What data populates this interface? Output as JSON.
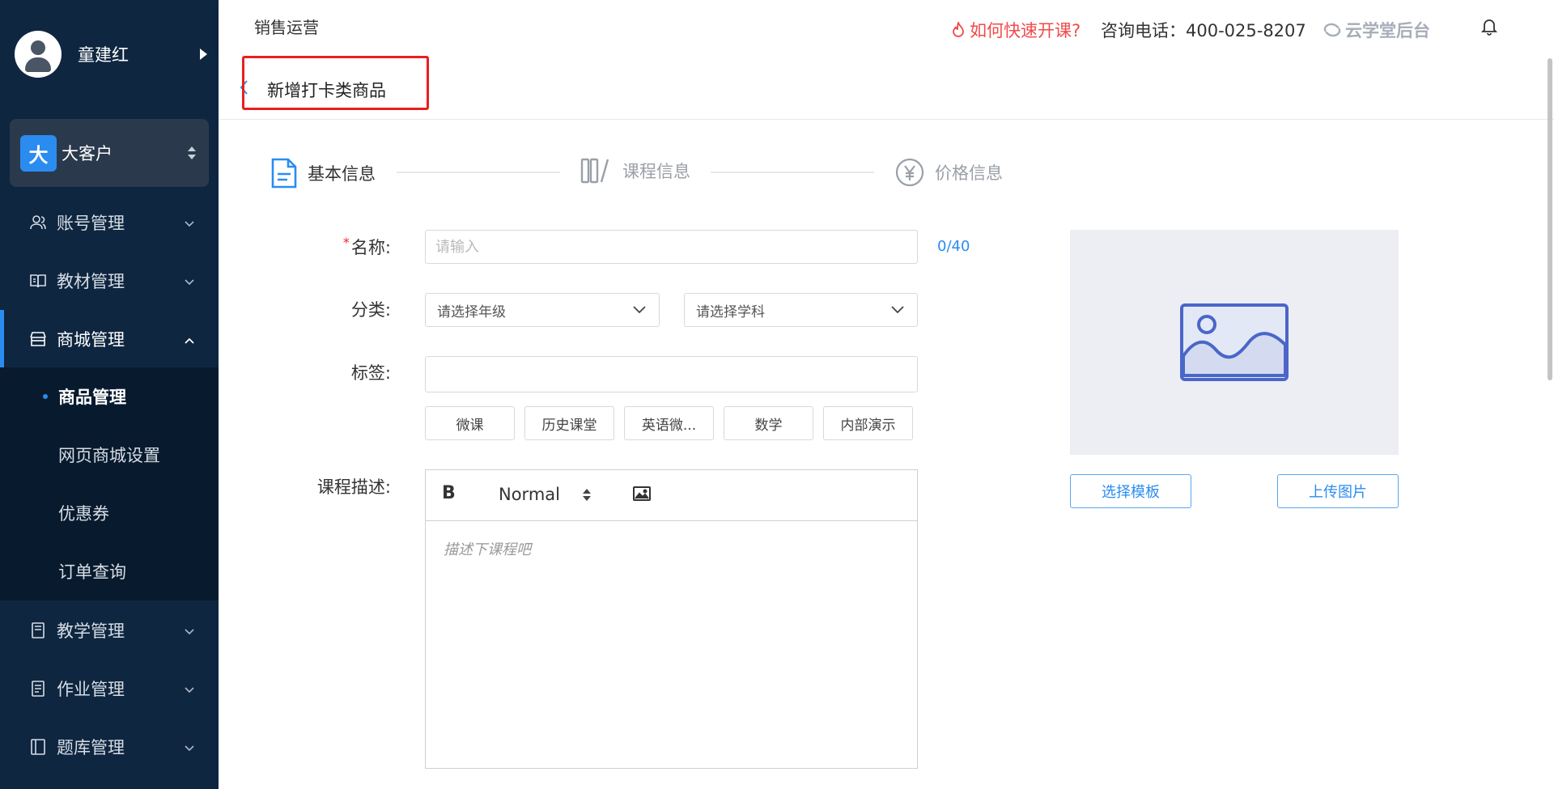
{
  "sidebar": {
    "user_name": "童建红",
    "org": {
      "badge": "大",
      "name": "大客户"
    },
    "menu": {
      "account": "账号管理",
      "textbook": "教材管理",
      "mall": "商城管理",
      "teaching": "教学管理",
      "homework": "作业管理",
      "question_bank": "题库管理"
    },
    "mall_sub": {
      "products": "商品管理",
      "web_mall": "网页商城设置",
      "coupons": "优惠券",
      "orders": "订单查询"
    },
    "active_menu": "商城管理",
    "active_sub": "商品管理"
  },
  "topbar": {
    "breadcrumb": "销售运营",
    "help_link": "如何快速开课?",
    "hotline": "咨询电话：400-025-8207",
    "brand": "云学堂后台"
  },
  "page": {
    "title": "新增打卡类商品"
  },
  "steps": [
    {
      "label": "基本信息",
      "state": "current"
    },
    {
      "label": "课程信息",
      "state": "pending"
    },
    {
      "label": "价格信息",
      "state": "pending"
    }
  ],
  "form": {
    "name_label": "名称:",
    "name_required_mark": "*",
    "name_placeholder": "请输入",
    "name_value": "",
    "name_counter": "0/40",
    "category_label": "分类:",
    "grade_select": "请选择年级",
    "subject_select": "请选择学科",
    "tags_label": "标签:",
    "tags_value": "",
    "tag_options": [
      "微课",
      "历史课堂",
      "英语微...",
      "数学",
      "内部演示"
    ],
    "desc_label": "课程描述:",
    "editor": {
      "bold": "B",
      "font_size": "Normal",
      "placeholder": "描述下课程吧"
    }
  },
  "image_panel": {
    "choose_template": "选择模板",
    "upload_image": "上传图片"
  },
  "colors": {
    "sidebar_bg": "#0f2640",
    "accent": "#2b8cf0",
    "help_red": "#f04a4a",
    "highlight_red": "#e8201f"
  }
}
